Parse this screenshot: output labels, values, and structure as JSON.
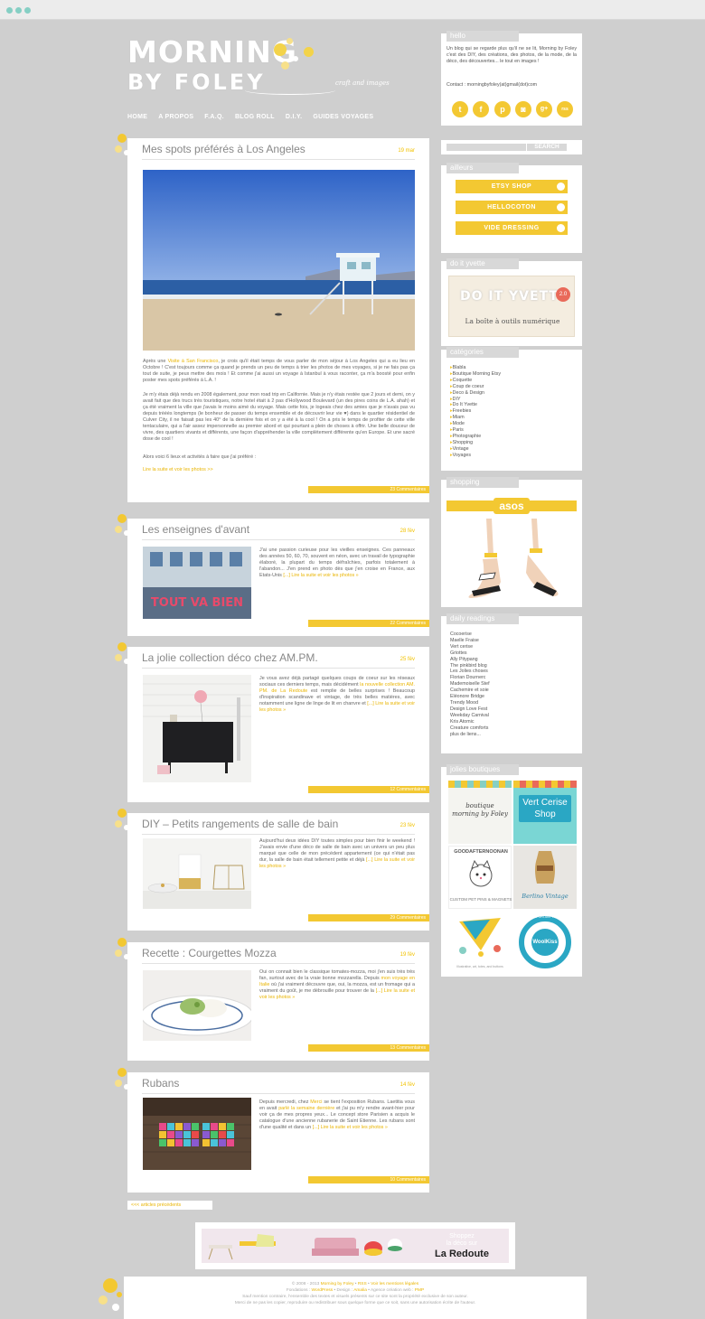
{
  "site": {
    "logo_line1": "MORNING",
    "logo_line2": "BY FOLEY",
    "tagline": "craft and images"
  },
  "nav": [
    "HOME",
    "A PROPOS",
    "F.A.Q.",
    "BLOG ROLL",
    "D.I.Y.",
    "GUIDES VOYAGES"
  ],
  "posts": [
    {
      "title": "Mes spots préférés à Los Angeles",
      "date": "19 mar",
      "p1_a": "Après une ",
      "p1_link": "Visite à San Francisco",
      "p1_b": ", je crois qu'il était temps de vous parler de mon séjour à Los Angeles qui a eu lieu en Octobre ! C'est toujours comme ça quand je prends un peu de temps à trier les photos de mes voyages, si je ne fais pas ça tout de suite, je peux mettre des mois ! Et comme j'ai aussi un voyage à Istanbul à vous raconter, ça m'a boosté pour enfin poster mes spots préférés à L.A. !",
      "p2": "Je m'y étais déjà rendu en 2008 également, pour mon road trip en Californie. Mais je n'y étais restée que 2 jours et demi, on y avait fait que des trucs très touristiques, notre hotel était à 2 pas d'Hollywood Boulevard (un des pires coins de L.A. ahah) et ça été vraiment la ville que j'avais le moins aimé du voyage. Mais cette fois, je logeais chez des amies que je n'avais pas vu depuis trèèès longtemps (le bonheur de passer du temps ensemble et de découvrir leur vie ♥) dans le quartier résidentiel de Culver City, il ne faisait pas les 40° de la dernière fois et on y a été à la cool ! On a pris le temps de profiter de cette ville tentaculaire, qui a l'air assez impersonnelle au premier abord et qui pourtant a plein de choses à offrir. Une belle douceur de vivre, des quartiers vivants et différents, une façon d'appréhender la ville complètement différente qu'en Europe. Et une sacré dose de cool !",
      "p3": "Alors voici 6 lieux et activités à faire que j'ai préféré :",
      "more": "Lire la suite et voir les photos >>",
      "comments": "23 Commentaires"
    },
    {
      "title": "Les enseignes d'avant",
      "date": "28 fév",
      "text": "J'ai une passion curieuse pour les vieilles enseignes. Ces panneaux des années 50, 60, 70, souvent en néon, avec un travail de typographie élaboré, la plupart du temps défraîchies, parfois totalement à l'abandon... J'en prend en photo dès que j'en croise en France, aux Etats-Unis ",
      "more": "[...] Lire la suite et voir les photos »",
      "comments": "22 Commentaires",
      "sign": "TOUT VA BIEN"
    },
    {
      "title": "La jolie collection déco chez AM.PM.",
      "date": "25 fév",
      "text_a": "Je vous avez déjà partagé quelques coups de coeur sur les réseaux sociaux ces derniers temps, mais décidément ",
      "text_link": "la nouvelle collection AM. PM. de La Redoute",
      "text_b": " est remplie de belles surprises ! Beaucoup d'inspiration scandinave et vintage, de très belles matières, avec notamment une ligne de linge de lit en chanvre et ",
      "more": "[...] Lire la suite et voir les photos »",
      "comments": "12 Commentaires"
    },
    {
      "title": "DIY – Petits rangements de salle de bain",
      "date": "23 fév",
      "text": "Aujourd'hui deux idées DIY toutes simples pour bien finir le weekend ! J'avais envie d'une déco de salle de bain avec un univers un peu plus marqué que celle de mon précédent appartement (ce qui n'était pas dur, la salle de bain était tellement petite et déjà ",
      "more": "[...] Lire la suite et voir les photos »",
      "comments": "29 Commentaires"
    },
    {
      "title": "Recette : Courgettes Mozza",
      "date": "19 fév",
      "text": "Oui on connait bien le classique tomates-mozza, moi j'en suis très très fan, surtout avec de la vraie bonne mozzarella. Depuis ",
      "text_link": "mon voyage en Italie",
      "text_b": " où j'ai vraiment découvre que, oui, la mozza, est un fromage qui a vraiment du goût, je me débrouille pour trouver de la ",
      "more": "[...] Lire la suite et voir les photos »",
      "comments": "13 Commentaires"
    },
    {
      "title": "Rubans",
      "date": "14 fév",
      "text_a": "Depuis mercredi, chez ",
      "text_link": "Merci",
      "text_b": " se tient l'exposition Rubans. Laetitia vous en avait ",
      "text_link2": "parlé la semaine dernière",
      "text_c": " et j'ai pu m'y rendre avant-hier pour voir ça de mes propres yeux... Le concept store Parisien a acquis le catalogue d'une ancienne rubanerie de Saint Etienne. Les rubans sont d'une qualité et dans un ",
      "more": "[...] Lire la suite et voir les photos »",
      "comments": "10 Commentaires"
    }
  ],
  "prev_link": "<<< articles précédents",
  "sidebar": {
    "hello": {
      "heading": "hello",
      "text": "Un blog qui se regarde plus qu'il ne se lit, Morning by Foley c'est des DIY, des créations, des photos, de la mode, de la déco, des découvertes... le tout en images !",
      "contact": "Contact : morningbyfoley(at)gmail(dot)com",
      "icons": [
        "t",
        "f",
        "p",
        "◙",
        "g+",
        "rss"
      ]
    },
    "search_button": "SEARCH",
    "ailleurs": {
      "heading": "ailleurs",
      "buttons": [
        "ETSY SHOP",
        "HELLOCOTON",
        "VIDE DRESSING"
      ]
    },
    "doityvette": {
      "heading": "do it yvette",
      "title": "DO IT YVETTE",
      "badge": "2.0",
      "subtitle": "La boîte à outils numérique"
    },
    "categories": {
      "heading": "catégories",
      "items": [
        "Blabla",
        "Boutique Morning Etsy",
        "Coquette",
        "Coup de coeur",
        "Deco & Design",
        "DIY",
        "Do It Yvette",
        "Freebies",
        "Miam",
        "Mode",
        "Paris",
        "Photographie",
        "Shopping",
        "Vintage",
        "Voyages"
      ]
    },
    "shopping": {
      "heading": "shopping",
      "brand": "asos"
    },
    "daily": {
      "heading": "daily readings",
      "items": [
        "Cocoerise",
        "Maelle Fraise",
        "Vert cerise",
        "Griottes",
        "Ally Pitypang",
        "The pinkbird blog",
        "Les Jolies choses",
        "Florian Dournerc",
        "Mademoiselle Stef",
        "Cachemire et soie",
        "Eléonore Bridge",
        "Trendy Mood",
        "Design Love Fest",
        "Weekday Carnival",
        "Kris Atomic",
        "Creature comforts",
        "plus de liens..."
      ]
    },
    "boutiques": {
      "heading": "jolies boutiques",
      "tiles": [
        "boutique morning by Foley",
        "Vert Cerise Shop",
        "GOODAFTERNOONAN",
        "Vintage",
        "",
        "WoolKiss"
      ],
      "cap_goodafternoon": "CUSTOM PET PINS & MAGNETS",
      "cap_vintage": "Berlino Vintage",
      "cap_flags": "Illustrative, art, totes, and buttons",
      "ring_text": "VERY IMPORTANT TOTEUSE"
    }
  },
  "banner": {
    "line1": "Shoppez",
    "line2": "la déco sur",
    "brand": "La Redoute"
  },
  "footer": {
    "line1_a": "© 2008 - 2013 ",
    "line1_link1": "Morning by Foley",
    "line1_b": " • ",
    "line1_link2": "RSS",
    "line1_c": " • ",
    "line1_link3": "Voir les mentions légales",
    "line2_a": "Fondations : ",
    "line2_link1": "WordPress",
    "line2_b": " • Design : ",
    "line2_link2": "Amalia",
    "line2_c": " • Agence création web : ",
    "line2_link3": "PMP",
    "line3": "Sauf mention contraire, l'ensemble des textes et visuels présents sur ce site sont la propriété exclusive de son auteur.",
    "line4": "Merci de ne pas les copier, reproduire ou redistribuer sous quelque forme que ce soit, sans une autorisation écrite de l'auteur."
  },
  "colors": {
    "accent": "#f3c832",
    "background": "#cfcfcf",
    "window_dots": "#86cfc4"
  }
}
